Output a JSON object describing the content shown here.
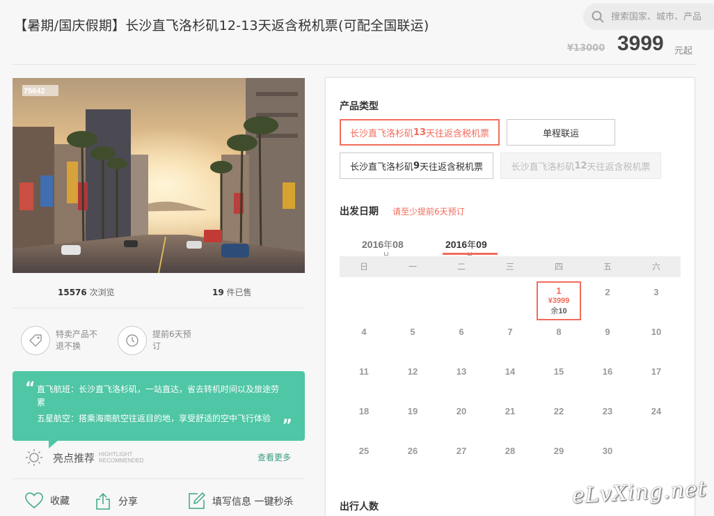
{
  "header": {
    "title": "【暑期/国庆假期】长沙直飞洛杉矶12-13天返含税机票(可配全国联运)",
    "search_placeholder": "搜索国家、城市、产品",
    "price_original": "¥13000",
    "price_current": "3999",
    "price_unit": "元起"
  },
  "photo": {
    "caption": "75642"
  },
  "stats": {
    "views_count": "15576",
    "views_label": "次浏览",
    "sold_count": "19",
    "sold_label": "件已售"
  },
  "features": [
    {
      "icon": "tag-icon",
      "text": "特卖产品不退不换"
    },
    {
      "icon": "clock-icon",
      "text": "提前6天预订"
    }
  ],
  "quote": {
    "line1": "直飞航班：长沙直飞洛杉矶，一站直达，省去转机时间以及旅途劳累",
    "line2": "五星航空：搭乘海南航空往返目的地，享受舒适的空中飞行体验"
  },
  "highlights": {
    "title": "亮点推荐",
    "sub1": "HIGHTLIGHT",
    "sub2": "RECOMMENDED",
    "more": "查看更多"
  },
  "actions": {
    "favorite": "收藏",
    "share": "分享",
    "fill_info": "填写信息 一键秒杀"
  },
  "booking": {
    "product_type_title": "产品类型",
    "options": [
      {
        "label_pre": "长沙直飞洛杉矶",
        "label_num": "13",
        "label_post": "天往返含税机票",
        "state": "selected"
      },
      {
        "label_pre": "单程联运",
        "label_num": "",
        "label_post": "",
        "state": "normal"
      },
      {
        "label_pre": "长沙直飞洛杉矶",
        "label_num": "9",
        "label_post": "天往返含税机票",
        "state": "normal"
      },
      {
        "label_pre": "长沙直飞洛杉矶",
        "label_num": "12",
        "label_post": "天往返含税机票",
        "state": "disabled"
      }
    ],
    "date_title": "出发日期",
    "date_hint": "请至少提前6天预订",
    "months": [
      {
        "year": "2016",
        "unit": "年",
        "month": "08",
        "active": false
      },
      {
        "year": "2016",
        "unit": "年",
        "month": "09",
        "active": true
      }
    ],
    "weekdays": [
      "日",
      "一",
      "二",
      "三",
      "四",
      "五",
      "六"
    ],
    "days": [
      "",
      "",
      "",
      "",
      {
        "d": "1",
        "price": "¥3999",
        "left_label": "余",
        "left": "10"
      },
      "2",
      "3",
      "4",
      "5",
      "6",
      "7",
      "8",
      "9",
      "10",
      "11",
      "12",
      "13",
      "14",
      "15",
      "16",
      "17",
      "18",
      "19",
      "20",
      "21",
      "22",
      "23",
      "24",
      "25",
      "26",
      "27",
      "28",
      "29",
      "30"
    ],
    "travelers_title": "出行人数"
  },
  "watermark": "eLvXing.net"
}
